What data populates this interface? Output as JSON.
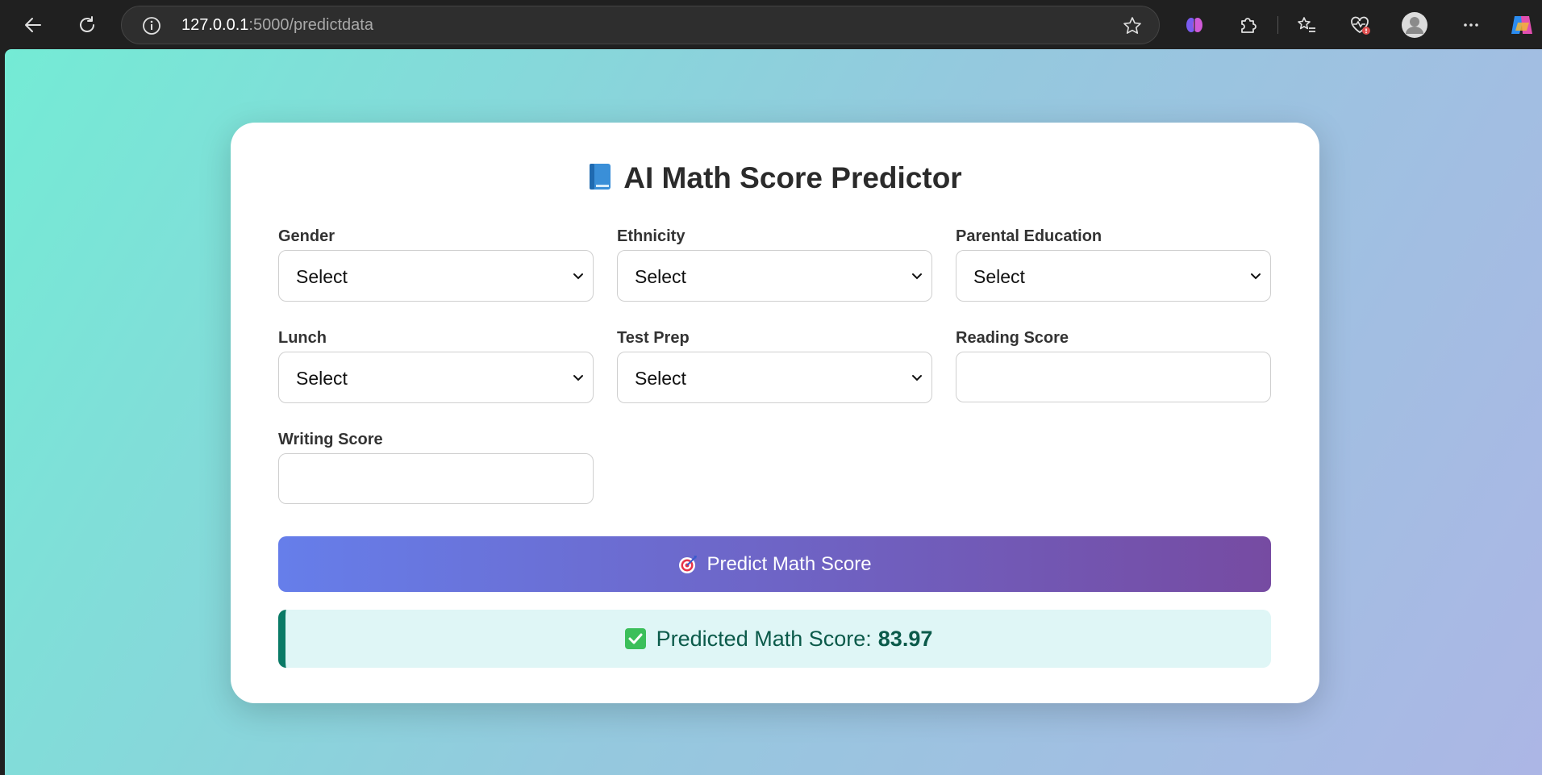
{
  "browser": {
    "url_host": "127.0.0.1",
    "url_path": ":5000/predictdata"
  },
  "page": {
    "title": "AI Math Score Predictor",
    "fields": {
      "gender": {
        "label": "Gender",
        "value": "Select"
      },
      "ethnicity": {
        "label": "Ethnicity",
        "value": "Select"
      },
      "parental_education": {
        "label": "Parental Education",
        "value": "Select"
      },
      "lunch": {
        "label": "Lunch",
        "value": "Select"
      },
      "test_prep": {
        "label": "Test Prep",
        "value": "Select"
      },
      "reading_score": {
        "label": "Reading Score",
        "value": ""
      },
      "writing_score": {
        "label": "Writing Score",
        "value": ""
      }
    },
    "predict_button": "Predict Math Score",
    "result_label": "Predicted Math Score:",
    "result_value": "83.97"
  },
  "colors": {
    "button_gradient": [
      "#667eea",
      "#764ba2"
    ],
    "result_accent": "#0a7a66"
  }
}
